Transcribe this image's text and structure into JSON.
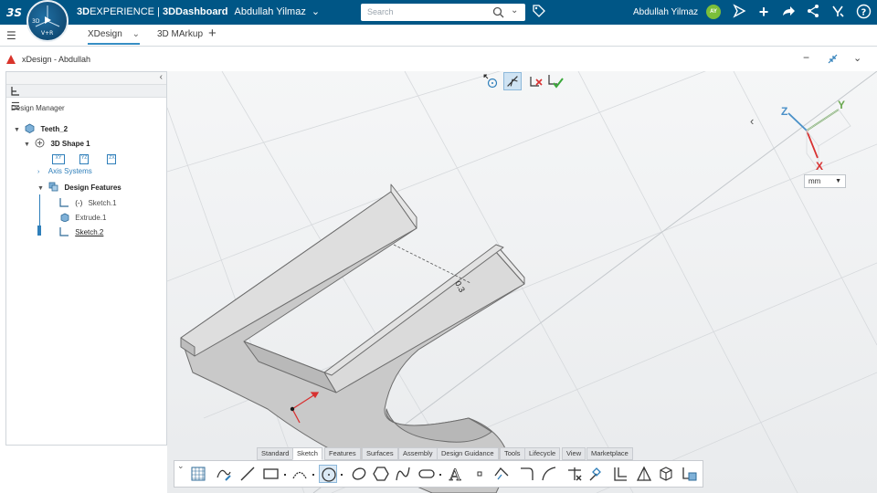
{
  "topbar": {
    "brand_prefix": "3D",
    "brand_rest": "EXPERIENCE | ",
    "app_name": "3DDashboard",
    "user_in_brand": "Abdullah Yilmaz",
    "search_placeholder": "Search",
    "username": "Abdullah Yilmaz",
    "avatar_initials": "AY",
    "compass_labels": [
      "V+R",
      "3D"
    ],
    "icons": [
      "ds-logo-icon",
      "search-icon",
      "chevron-down-icon",
      "tag-icon",
      "send-icon",
      "plus-icon",
      "share-icon",
      "network-icon",
      "tools-icon",
      "help-icon"
    ],
    "bar_color": "#005686"
  },
  "tabs": {
    "items": [
      {
        "label": "XDesign",
        "active": true
      },
      {
        "label": "3D MArkup",
        "active": false
      }
    ],
    "add_label": "+"
  },
  "app_title": "xDesign - Abdullah",
  "design_manager": {
    "label": "Design Manager",
    "tree": {
      "root": "Teeth_2",
      "shape": "3D Shape 1",
      "planes": [
        "XY",
        "YZ",
        "ZX"
      ],
      "axis_systems": "Axis Systems",
      "design_features": "Design Features",
      "features": [
        "Sketch.1",
        "Extrude.1",
        "Sketch.2"
      ]
    }
  },
  "viewport": {
    "units": "mm",
    "axis_labels": [
      "X",
      "Y",
      "Z"
    ],
    "dimension_label": "0.3",
    "model_color": "#c8c8c8"
  },
  "section_tabs": [
    "Standard",
    "Sketch",
    "Features",
    "Surfaces",
    "Assembly",
    "Design Guidance",
    "Tools",
    "Lifecycle",
    "View",
    "Marketplace"
  ],
  "active_section": "Sketch",
  "sketch_tools": [
    "grid-icon",
    "pencil-icon",
    "line-icon",
    "rectangle-icon",
    "arc-icon",
    "circle-icon",
    "ellipse-icon",
    "hexagon-icon",
    "spline-icon",
    "slot-icon",
    "text-icon",
    "point-icon",
    "offset-icon",
    "corner-icon",
    "fillet-icon",
    "trim-icon",
    "fix-icon",
    "constraint-icon",
    "triangle-icon",
    "box-icon",
    "project-icon"
  ]
}
